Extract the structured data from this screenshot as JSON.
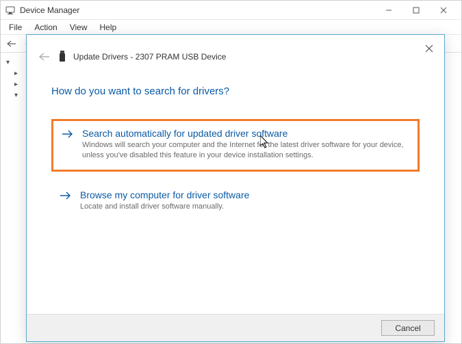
{
  "main_window": {
    "title": "Device Manager",
    "menubar": [
      "File",
      "Action",
      "View",
      "Help"
    ]
  },
  "dialog": {
    "title": "Update Drivers - 2307 PRAM USB Device",
    "heading": "How do you want to search for drivers?",
    "options": [
      {
        "title": "Search automatically for updated driver software",
        "desc": "Windows will search your computer and the Internet for the latest driver software for your device, unless you've disabled this feature in your device installation settings.",
        "highlighted": true
      },
      {
        "title": "Browse my computer for driver software",
        "desc": "Locate and install driver software manually.",
        "highlighted": false
      }
    ],
    "cancel_label": "Cancel"
  }
}
